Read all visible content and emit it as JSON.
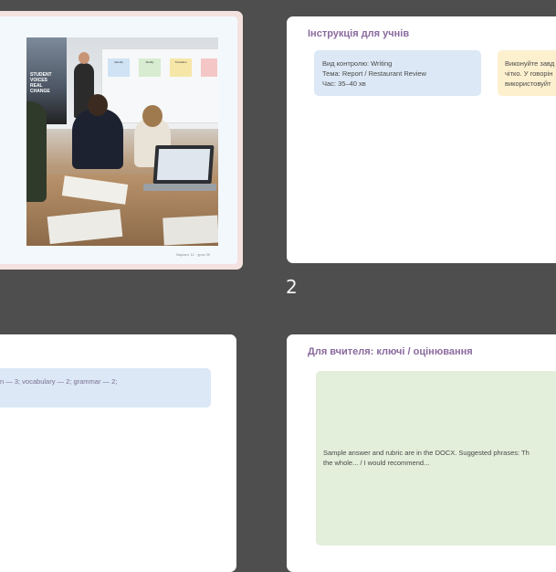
{
  "slides": [
    {
      "id": 1,
      "selected": true,
      "image_alt": "Students writing reports in a classroom",
      "poster_text": "STUDENT VOICES REAL CHANGE",
      "board_notes": [
        "Identify",
        "Modify",
        "Transition"
      ],
      "footer": "Варіант 11 · урок 39"
    },
    {
      "id": 2,
      "title": "Інструкція для учнів",
      "info_lines": [
        "Вид контролю: Writing",
        "Тема: Report / Restaurant Review",
        "Час: 35–40 хв"
      ],
      "note_lines": [
        "Виконуйте завд",
        "чітко. У говорін",
        "використовуйт"
      ]
    },
    {
      "id": 3,
      "rubric_text": "n — 3; vocabulary — 2; grammar — 2;"
    },
    {
      "id": 4,
      "title": "Для вчителя: ключі / оцінювання",
      "body_lines": [
        "Sample answer and rubric are in the DOCX. Suggested phrases: Th",
        "the whole... / I would recommend..."
      ]
    }
  ],
  "page_number": "2",
  "colors": {
    "background": "#4e4e4e",
    "title": "#8a6a9e",
    "blue_box": "#dce8f5",
    "yellow_box": "#fdf0cf",
    "green_box": "#e3eedb",
    "selected_border": "#f3e2e0"
  }
}
